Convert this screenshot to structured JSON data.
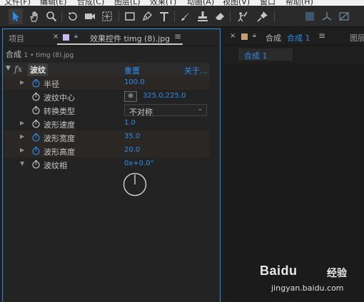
{
  "menubar": {
    "items": [
      "文件(F)",
      "编辑(E)",
      "合成(C)",
      "图层(L)",
      "效果(T)",
      "动画(A)",
      "视图(V)",
      "窗口",
      "帮助(H)"
    ]
  },
  "toolbar": {
    "tools": [
      "selection-tool-icon",
      "hand-tool-icon",
      "zoom-tool-icon",
      "rotate-tool-icon",
      "camera-tool-icon",
      "pan-behind-tool-icon",
      "rectangle-tool-icon",
      "pen-tool-icon",
      "text-tool-icon",
      "brush-tool-icon",
      "clone-stamp-tool-icon",
      "eraser-tool-icon",
      "roto-brush-tool-icon",
      "puppet-pin-tool-icon"
    ]
  },
  "left_panel": {
    "tab_project": "项目",
    "tab_effects": "效果控件 timg (8).jpg",
    "tab_effects_color": "#c8b8f0",
    "breadcrumb_comp": "合成",
    "breadcrumb_layer": "1 • timg (8).jpg",
    "effect": {
      "fx_label": "fx",
      "name": "波纹",
      "reset": "重置",
      "about": "关于..."
    },
    "properties": [
      {
        "label": "半径",
        "value": "100.0"
      },
      {
        "label": "波纹中心",
        "value": "325.0,225.0"
      },
      {
        "label": "转换类型",
        "value": "不对称"
      },
      {
        "label": "波形速度",
        "value": "1.0"
      },
      {
        "label": "波形宽度",
        "value": "35.0"
      },
      {
        "label": "波形高度",
        "value": "20.0"
      },
      {
        "label": "波纹相",
        "value": "0x+0.0°"
      }
    ]
  },
  "right_panel": {
    "tab_comp": "合成",
    "tab_comp_name": "合成 1",
    "tab_layer": "图层",
    "comp_chip": "合成 1"
  },
  "watermark": {
    "logo": "Bai⁠du",
    "text": "经验",
    "url": "jingyan.baidu.com"
  },
  "colors": {
    "accent": "#2d8ceb",
    "background": "#232323"
  }
}
